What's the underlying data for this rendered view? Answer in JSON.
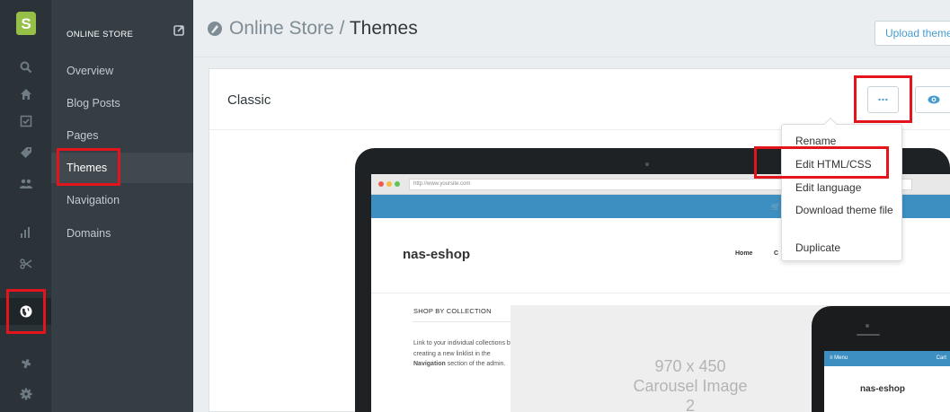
{
  "rail": {
    "logo_letter": "S",
    "icons": [
      "search-icon",
      "home-icon",
      "orders-icon",
      "products-icon",
      "customers-icon",
      "reports-icon",
      "discounts-icon",
      "online-store-icon",
      "apps-icon",
      "settings-icon"
    ]
  },
  "subnav": {
    "heading": "ONLINE STORE",
    "items": [
      {
        "label": "Overview"
      },
      {
        "label": "Blog Posts"
      },
      {
        "label": "Pages"
      },
      {
        "label": "Themes"
      },
      {
        "label": "Navigation"
      },
      {
        "label": "Domains"
      }
    ]
  },
  "header": {
    "breadcrumb_parent": "Online Store",
    "separator": " / ",
    "title": "Themes",
    "upload_button": "Upload theme"
  },
  "theme_card": {
    "title": "Classic",
    "more_button": "...",
    "menu": {
      "items": [
        "Rename",
        "Edit HTML/CSS",
        "Edit language",
        "Download theme file",
        "Duplicate"
      ]
    }
  },
  "preview": {
    "url": "http://www.yoursite.com",
    "shop_name": "nas-eshop",
    "nav_home": "Home",
    "nav_partial": "C",
    "sidebar_heading": "SHOP BY COLLECTION",
    "sidebar_text_1": "Link to your individual collections by creating a new linklist in the ",
    "sidebar_text_bold": "Navigation",
    "sidebar_text_2": " section of the admin.",
    "carousel_size": "970 x 450",
    "carousel_label": "Carousel Image",
    "carousel_index": "2",
    "mobile_menu": "≡ Menu",
    "mobile_cart": "Cart",
    "mobile_shop_name": "nas-eshop"
  },
  "colors": {
    "accent": "#479ccf",
    "highlight": "#e3141b",
    "shopify_green": "#95bf47"
  }
}
